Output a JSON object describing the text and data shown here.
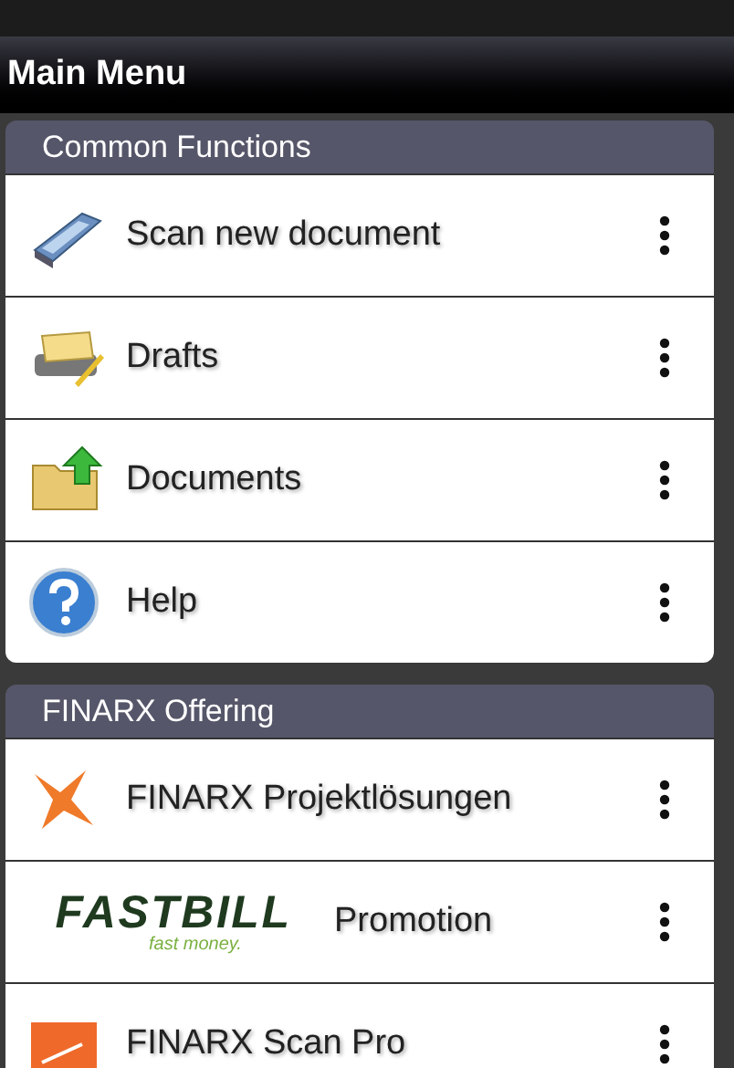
{
  "title": "Main Menu",
  "sections": [
    {
      "header": "Common Functions",
      "items": [
        {
          "kind": "icon",
          "label": "Scan new document"
        },
        {
          "kind": "icon",
          "label": "Drafts"
        },
        {
          "kind": "icon",
          "label": "Documents"
        },
        {
          "kind": "icon",
          "label": "Help"
        }
      ]
    },
    {
      "header": "FINARX Offering",
      "items": [
        {
          "kind": "icon",
          "label": "FINARX Projektlösungen"
        },
        {
          "kind": "logo",
          "label": "Promotion",
          "logo_text": "FASTBILL",
          "logo_tagline": "fast money."
        },
        {
          "kind": "icon",
          "label": "FINARX Scan Pro"
        }
      ]
    }
  ]
}
